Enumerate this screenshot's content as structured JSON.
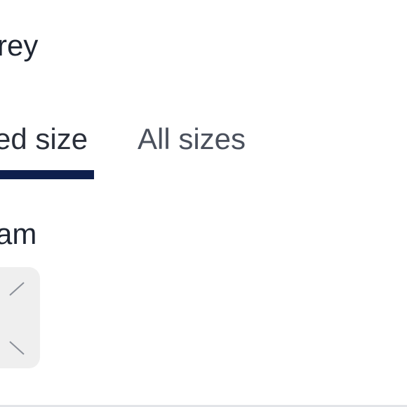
{
  "product": {
    "color_label": "rey"
  },
  "size_tabs": {
    "selected_label": "ed size",
    "all_label": "All sizes"
  },
  "size_section": {
    "label": "am"
  },
  "colors": {
    "underline": "#0e1f4d",
    "tile_background": "#efefef"
  }
}
